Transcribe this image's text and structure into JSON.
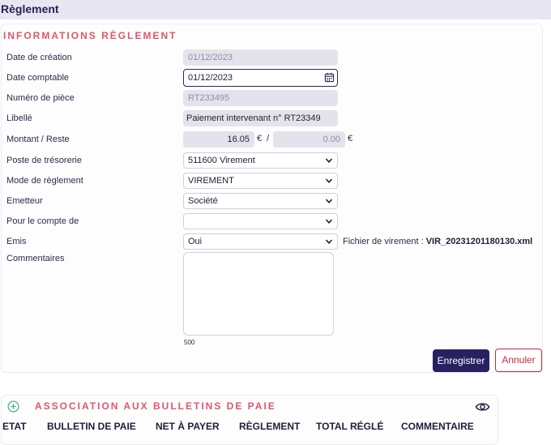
{
  "header": {
    "title": "Règlement"
  },
  "form": {
    "section_title": "INFORMATIONS RÈGLEMENT",
    "labels": {
      "date_creation": "Date de création",
      "date_comptable": "Date comptable",
      "numero_piece": "Numéro de pièce",
      "libelle": "Libellé",
      "montant_reste": "Montant / Reste",
      "poste_tresorerie": "Poste de trésorerie",
      "mode_reglement": "Mode de règlement",
      "emetteur": "Emetteur",
      "pour_compte": "Pour le compte de",
      "emis": "Emis",
      "commentaires": "Commentaires"
    },
    "values": {
      "date_creation": "01/12/2023",
      "date_comptable": "01/12/2023",
      "numero_piece": "RT233495",
      "libelle": "Paiement intervenant n° RT23349",
      "montant": "16.05",
      "reste": "0.00",
      "currency": "€",
      "separator": "/",
      "poste_tresorerie": "511600 Virement",
      "mode_reglement": "VIREMENT",
      "emetteur": "Société",
      "pour_compte": "",
      "emis": "Oui",
      "commentaires": ""
    },
    "char_counter": "500",
    "fichier_label": "Fichier de virement : ",
    "fichier_value": "VIR_20231201180130.xml",
    "buttons": {
      "save": "Enregistrer",
      "cancel": "Annuler"
    }
  },
  "association": {
    "title": "ASSOCIATION AUX BULLETINS DE PAIE",
    "columns": [
      "ETAT",
      "BULLETIN DE PAIE",
      "NET À PAYER",
      "RÈGLEMENT",
      "TOTAL RÉGLÉ",
      "COMMENTAIRE"
    ]
  },
  "icons": {
    "calendar": "calendar-icon",
    "chevron": "chevron-down-icon",
    "add": "add-circle-icon",
    "eye": "eye-icon"
  },
  "colors": {
    "accent": "#e0566a",
    "primary": "#262160",
    "danger": "#c42b3c",
    "topbar": "#e8e6f1",
    "readonly": "#e4e3ec"
  }
}
